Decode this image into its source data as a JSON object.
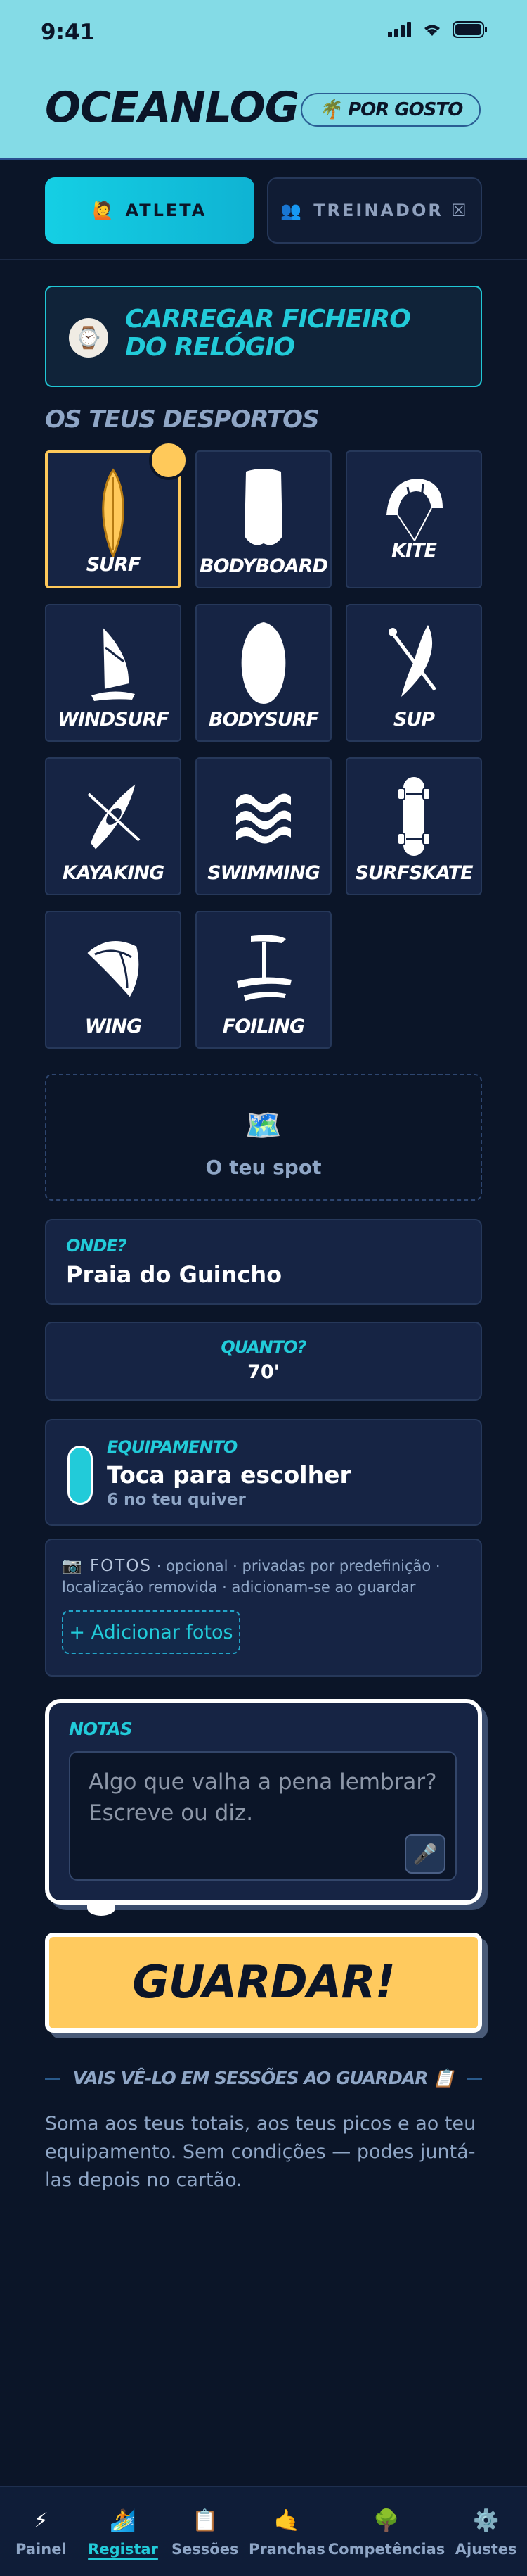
{
  "status": {
    "time": "9:41"
  },
  "header": {
    "title": "OCEANLOG",
    "mode_icon": "🌴",
    "mode_label": "POR GOSTO"
  },
  "roles": {
    "athlete": {
      "icon": "🙋",
      "label": "ATLETA"
    },
    "coach": {
      "icon": "👥",
      "label": "TREINADOR ☒"
    }
  },
  "upload": {
    "icon": "⌚",
    "label": "CARREGAR FICHEIRO DO RELÓGIO"
  },
  "sports_title": "OS TEUS DESPORTOS",
  "sports": [
    {
      "label": "SURF",
      "icon": "surfboard-icon",
      "selected": true
    },
    {
      "label": "BODYBOARD",
      "icon": "bodyboard-icon",
      "selected": false
    },
    {
      "label": "KITE",
      "icon": "kite-icon",
      "selected": false
    },
    {
      "label": "WINDSURF",
      "icon": "windsurf-icon",
      "selected": false
    },
    {
      "label": "BODYSURF",
      "icon": "handplane-icon",
      "selected": false
    },
    {
      "label": "SUP",
      "icon": "sup-paddle-icon",
      "selected": false
    },
    {
      "label": "KAYAKING",
      "icon": "kayak-icon",
      "selected": false
    },
    {
      "label": "SWIMMING",
      "icon": "waves-icon",
      "selected": false
    },
    {
      "label": "SURFSKATE",
      "icon": "skateboard-icon",
      "selected": false
    },
    {
      "label": "WING",
      "icon": "wing-icon",
      "selected": false
    },
    {
      "label": "FOILING",
      "icon": "foil-icon",
      "selected": false
    }
  ],
  "spot": {
    "icon": "🗺️",
    "label": "O teu spot"
  },
  "where": {
    "label": "ONDE?",
    "value": "Praia do Guincho"
  },
  "duration": {
    "label": "QUANTO?",
    "value": "70'"
  },
  "equipment": {
    "label": "EQUIPAMENTO",
    "value": "Toca para escolher",
    "sub": "6 no teu quiver"
  },
  "photos": {
    "lead": "📷 FOTOS",
    "note": " · opcional · privadas por predefinição · localização removida · adicionam-se ao guardar",
    "button": "+ Adicionar fotos"
  },
  "notes": {
    "label": "NOTAS",
    "placeholder": "Algo que valha a pena lembrar? Escreve ou diz.",
    "mic_icon": "🎤"
  },
  "save_label": "GUARDAR!",
  "info": {
    "title": "VAIS VÊ-LO EM SESSÕES AO GUARDAR 📋",
    "body": "Soma aos teus totais, aos teus picos e ao teu equipamento. Sem condições — podes juntá-las depois no cartão."
  },
  "nav": [
    {
      "icon": "⚡",
      "label": "Painel",
      "active": false
    },
    {
      "icon": "🏄",
      "label": "Registar",
      "active": true
    },
    {
      "icon": "📋",
      "label": "Sessões",
      "active": false
    },
    {
      "icon": "🤙",
      "label": "Pranchas",
      "active": false
    },
    {
      "icon": "🌳",
      "label": "Competências",
      "active": false
    },
    {
      "icon": "⚙️",
      "label": "Ajustes",
      "active": false
    }
  ],
  "colors": {
    "accent": "#22cbd9",
    "highlight": "#ffca5e",
    "background": "#0b1528",
    "header": "#84dbe6"
  }
}
